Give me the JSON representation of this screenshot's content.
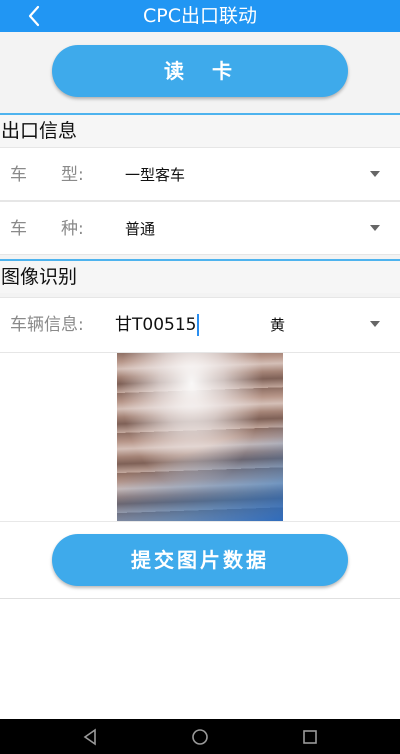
{
  "app": {
    "title": "CPC出口联动"
  },
  "buttons": {
    "read_card": "读　卡",
    "submit_image": "提交图片数据"
  },
  "exit_info": {
    "section_title": "出口信息",
    "vehicle_type": {
      "label": "车　　型:",
      "value": "一型客车"
    },
    "vehicle_kind": {
      "label": "车　　种:",
      "value": "普通"
    }
  },
  "image_recognition": {
    "section_title": "图像识别",
    "vehicle_info": {
      "label": "车辆信息:",
      "plate": "甘T00515",
      "plate_color": "黄"
    }
  },
  "colors": {
    "primary": "#2196f3",
    "button": "#3eaaeb",
    "navbar": "#000000"
  },
  "icons": {
    "back": "chevron-left-icon",
    "nav_back": "triangle-back-icon",
    "nav_home": "circle-home-icon",
    "nav_recent": "square-recent-icon"
  }
}
